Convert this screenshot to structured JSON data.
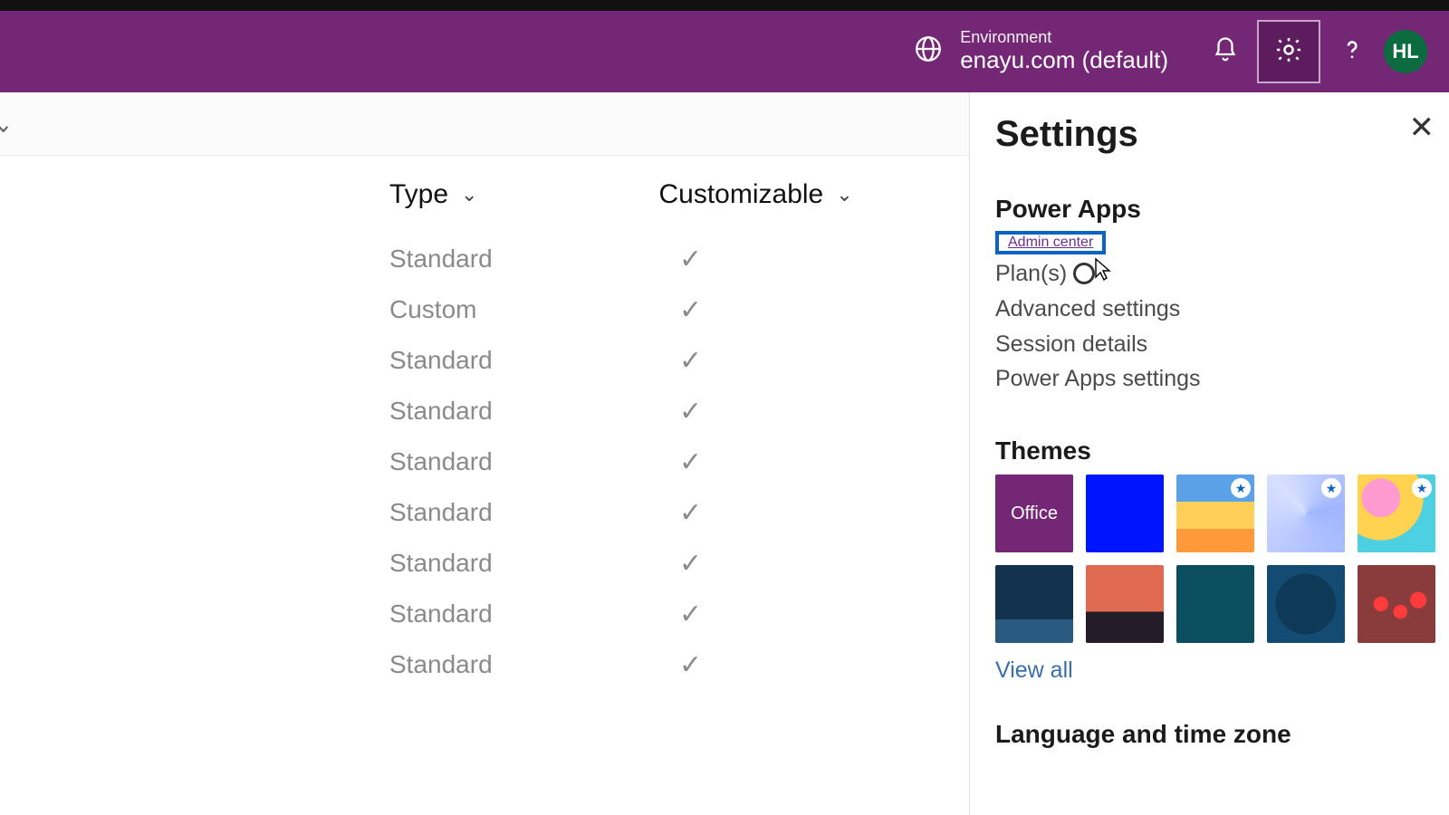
{
  "header": {
    "env_label": "Environment",
    "env_name": "enayu.com (default)",
    "avatar_initials": "HL"
  },
  "table": {
    "columns": {
      "type": "Type",
      "customizable": "Customizable"
    },
    "rows": [
      {
        "type": "Standard",
        "customizable": true
      },
      {
        "type": "Custom",
        "customizable": true
      },
      {
        "type": "Standard",
        "customizable": true
      },
      {
        "type": "Standard",
        "customizable": true
      },
      {
        "type": "Standard",
        "customizable": true
      },
      {
        "type": "Standard",
        "customizable": true
      },
      {
        "type": "Standard",
        "customizable": true
      },
      {
        "type": "Standard",
        "customizable": true
      },
      {
        "type": "Standard",
        "customizable": true
      }
    ]
  },
  "settings": {
    "title": "Settings",
    "sections": {
      "power_apps": {
        "title": "Power Apps",
        "links": {
          "admin_center": "Admin center",
          "plans": "Plan(s)",
          "advanced": "Advanced settings",
          "session": "Session details",
          "pa_settings": "Power Apps settings"
        }
      },
      "themes": {
        "title": "Themes",
        "office_label": "Office",
        "view_all": "View all"
      },
      "language": {
        "title": "Language and time zone"
      }
    }
  }
}
